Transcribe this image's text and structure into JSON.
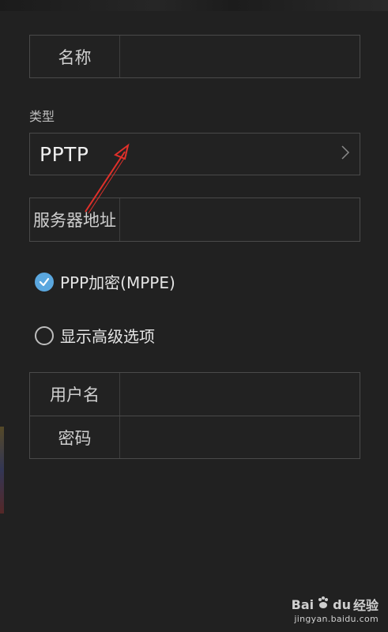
{
  "form": {
    "name_label": "名称",
    "name_value": "",
    "type_section_label": "类型",
    "type_value": "PPTP",
    "server_label": "服务器地址",
    "server_value": "",
    "ppp_encryption_label": "PPP加密(MPPE)",
    "ppp_encryption_checked": true,
    "advanced_label": "显示高级选项",
    "advanced_checked": false,
    "username_label": "用户名",
    "username_value": "",
    "password_label": "密码",
    "password_value": ""
  },
  "icons": {
    "chevron": "chevron-right-icon",
    "check": "check-icon",
    "arrow_annotation": "red-arrow-annotation"
  },
  "colors": {
    "background": "#212121",
    "checkbox_accent": "#5aa7df",
    "annotation_red": "#e0302a"
  },
  "watermark": {
    "brand_left": "Bai",
    "brand_right": "du",
    "brand_suffix": "经验",
    "url": "jingyan.baidu.com"
  }
}
